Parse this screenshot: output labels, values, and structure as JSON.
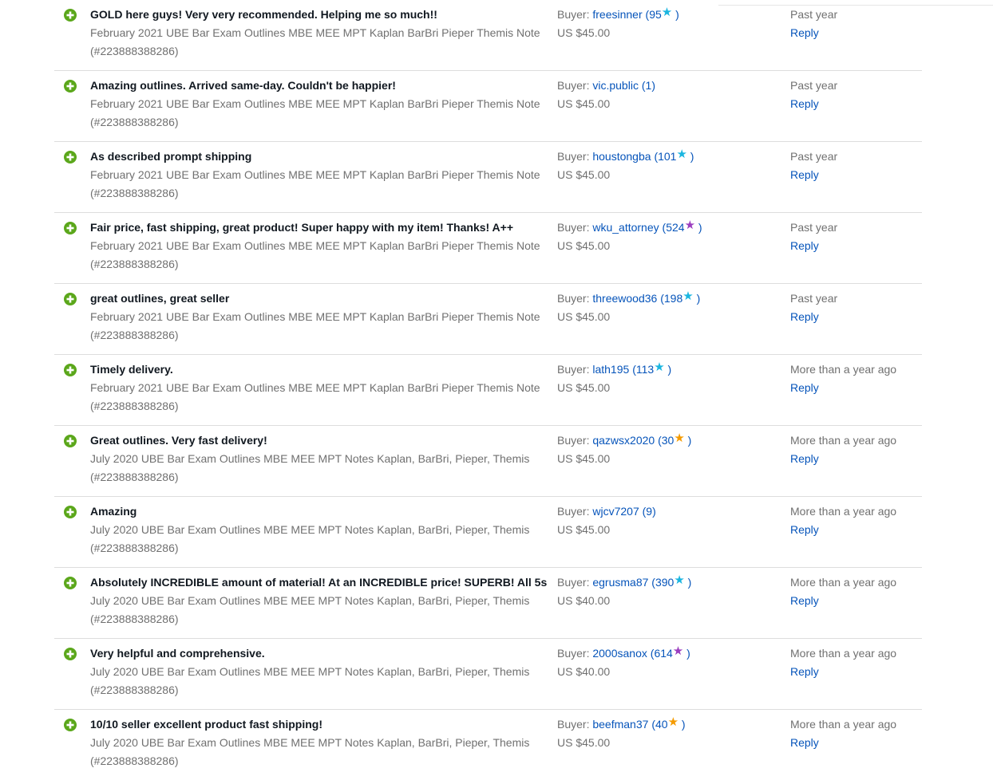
{
  "icon": {
    "name": "plus-circle-icon",
    "color": "#5ba71b"
  },
  "star_colors": {
    "turquoise": "#1bb6e0",
    "purple": "#9b3dbf",
    "yellow": "#f59b00"
  },
  "reviews": [
    {
      "comment": "GOLD here guys! Very very recommended. Helping me so much!!",
      "item_title": "February 2021 UBE Bar Exam Outlines MBE MEE MPT Kaplan BarBri Pieper Themis Note",
      "item_id": "(#223888388286)",
      "buyer_prefix": "Buyer:",
      "buyer": "freesinner",
      "score": "95",
      "star": "turquoise",
      "price": "US $45.00",
      "time": "Past year",
      "reply": "Reply"
    },
    {
      "comment": "Amazing outlines. Arrived same-day. Couldn't be happier!",
      "item_title": "February 2021 UBE Bar Exam Outlines MBE MEE MPT Kaplan BarBri Pieper Themis Note",
      "item_id": "(#223888388286)",
      "buyer_prefix": "Buyer:",
      "buyer": "vic.public",
      "score": "1",
      "star": "",
      "price": "US $45.00",
      "time": "Past year",
      "reply": "Reply"
    },
    {
      "comment": "As described prompt shipping",
      "item_title": "February 2021 UBE Bar Exam Outlines MBE MEE MPT Kaplan BarBri Pieper Themis Note",
      "item_id": "(#223888388286)",
      "buyer_prefix": "Buyer:",
      "buyer": "houstongba",
      "score": "101",
      "star": "turquoise",
      "price": "US $45.00",
      "time": "Past year",
      "reply": "Reply"
    },
    {
      "comment": "Fair price, fast shipping, great product! Super happy with my item! Thanks! A++",
      "item_title": "February 2021 UBE Bar Exam Outlines MBE MEE MPT Kaplan BarBri Pieper Themis Note",
      "item_id": "(#223888388286)",
      "buyer_prefix": "Buyer:",
      "buyer": "wku_attorney",
      "score": "524",
      "star": "purple",
      "price": "US $45.00",
      "time": "Past year",
      "reply": "Reply"
    },
    {
      "comment": "great outlines, great seller",
      "item_title": "February 2021 UBE Bar Exam Outlines MBE MEE MPT Kaplan BarBri Pieper Themis Note",
      "item_id": "(#223888388286)",
      "buyer_prefix": "Buyer:",
      "buyer": "threewood36",
      "score": "198",
      "star": "turquoise",
      "price": "US $45.00",
      "time": "Past year",
      "reply": "Reply"
    },
    {
      "comment": "Timely delivery.",
      "item_title": "February 2021 UBE Bar Exam Outlines MBE MEE MPT Kaplan BarBri Pieper Themis Note",
      "item_id": "(#223888388286)",
      "buyer_prefix": "Buyer:",
      "buyer": "lath195",
      "score": "113",
      "star": "turquoise",
      "price": "US $45.00",
      "time": "More than a year ago",
      "reply": "Reply"
    },
    {
      "comment": "Great outlines. Very fast delivery!",
      "item_title": "July 2020 UBE Bar Exam Outlines MBE MEE MPT Notes Kaplan, BarBri, Pieper, Themis",
      "item_id": "(#223888388286)",
      "buyer_prefix": "Buyer:",
      "buyer": "qazwsx2020",
      "score": "30",
      "star": "yellow",
      "price": "US $45.00",
      "time": "More than a year ago",
      "reply": "Reply"
    },
    {
      "comment": "Amazing",
      "item_title": "July 2020 UBE Bar Exam Outlines MBE MEE MPT Notes Kaplan, BarBri, Pieper, Themis",
      "item_id": "(#223888388286)",
      "buyer_prefix": "Buyer:",
      "buyer": "wjcv7207",
      "score": "9",
      "star": "",
      "price": "US $45.00",
      "time": "More than a year ago",
      "reply": "Reply"
    },
    {
      "comment": "Absolutely INCREDIBLE amount of material! At an INCREDIBLE price! SUPERB! All 5s",
      "item_title": "July 2020 UBE Bar Exam Outlines MBE MEE MPT Notes Kaplan, BarBri, Pieper, Themis",
      "item_id": "(#223888388286)",
      "buyer_prefix": "Buyer:",
      "buyer": "egrusma87",
      "score": "390",
      "star": "turquoise",
      "price": "US $40.00",
      "time": "More than a year ago",
      "reply": "Reply"
    },
    {
      "comment": "Very helpful and comprehensive.",
      "item_title": "July 2020 UBE Bar Exam Outlines MBE MEE MPT Notes Kaplan, BarBri, Pieper, Themis",
      "item_id": "(#223888388286)",
      "buyer_prefix": "Buyer:",
      "buyer": "2000sanox",
      "score": "614",
      "star": "purple",
      "price": "US $40.00",
      "time": "More than a year ago",
      "reply": "Reply"
    },
    {
      "comment": "10/10 seller excellent product fast shipping!",
      "item_title": "July 2020 UBE Bar Exam Outlines MBE MEE MPT Notes Kaplan, BarBri, Pieper, Themis",
      "item_id": "(#223888388286)",
      "buyer_prefix": "Buyer:",
      "buyer": "beefman37",
      "score": "40",
      "star": "yellow",
      "price": "US $45.00",
      "time": "More than a year ago",
      "reply": "Reply"
    }
  ]
}
